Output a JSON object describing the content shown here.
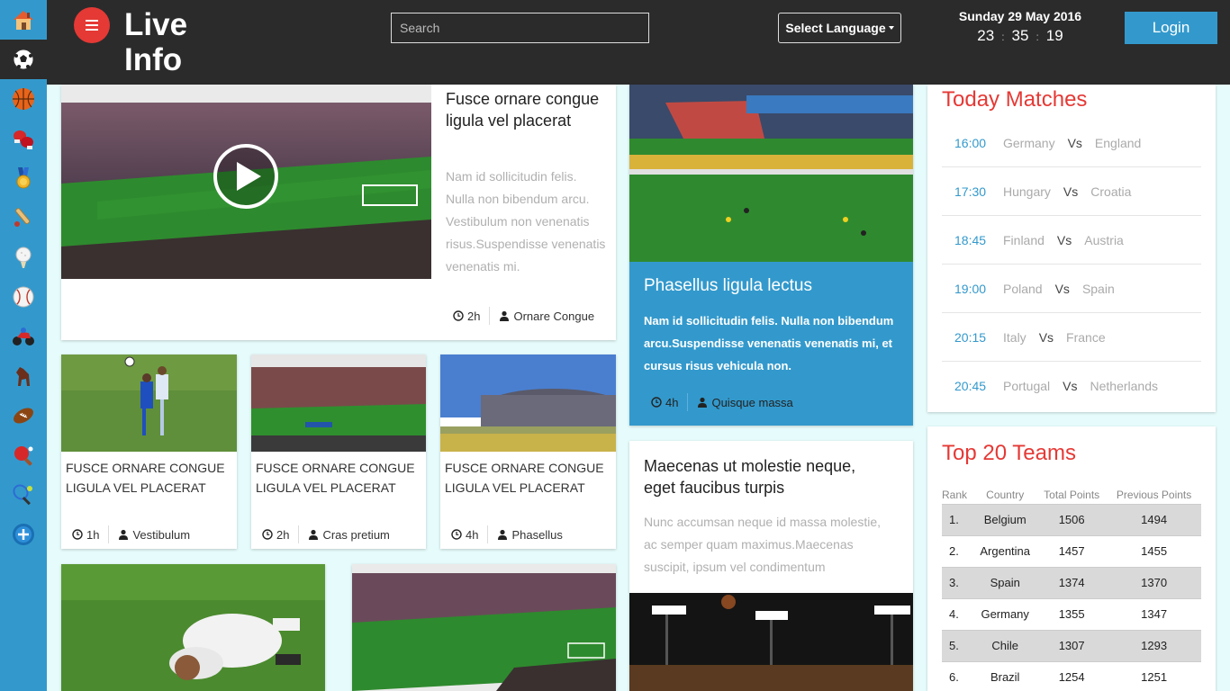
{
  "sidebar": {
    "items": [
      {
        "icon": "home-icon",
        "active": false
      },
      {
        "icon": "soccer-ball-icon",
        "active": true
      },
      {
        "icon": "basketball-icon",
        "active": false
      },
      {
        "icon": "boxing-glove-icon",
        "active": false
      },
      {
        "icon": "medal-icon",
        "active": false
      },
      {
        "icon": "cricket-bat-icon",
        "active": false
      },
      {
        "icon": "golf-ball-icon",
        "active": false
      },
      {
        "icon": "baseball-icon",
        "active": false
      },
      {
        "icon": "motorbike-icon",
        "active": false
      },
      {
        "icon": "horse-icon",
        "active": false
      },
      {
        "icon": "rugby-ball-icon",
        "active": false
      },
      {
        "icon": "table-tennis-icon",
        "active": false
      },
      {
        "icon": "tennis-icon",
        "active": false
      },
      {
        "icon": "more-icon",
        "active": false
      }
    ]
  },
  "header": {
    "logo_line1": "Live",
    "logo_line2": "Info",
    "search_placeholder": "Search",
    "language_label": "Select Language",
    "date": "Sunday 29 May 2016",
    "time": {
      "h": "23",
      "m": "35",
      "s": "19"
    },
    "login_label": "Login"
  },
  "featured": {
    "title": "Fusce ornare congue ligula vel placerat",
    "body": "Nam id sollicitudin felis. Nulla non bibendum arcu. Vestibulum non venenatis risus.Suspendisse venenatis venenatis mi.",
    "time": "2h",
    "author": "Ornare Congue"
  },
  "thumbs": [
    {
      "title": "Fusce ornare congue ligula vel placerat",
      "time": "1h",
      "author": "Vestibulum"
    },
    {
      "title": "Fusce ornare congue ligula vel placerat",
      "time": "2h",
      "author": "Cras pretium"
    },
    {
      "title": "Fusce ornare congue ligula vel placerat",
      "time": "4h",
      "author": "Phasellus"
    }
  ],
  "blue_card": {
    "title": "Phasellus ligula lectus",
    "body": "Nam id sollicitudin felis. Nulla non bibendum arcu.Suspendisse venenatis venenatis mi, et cursus risus vehicula non.",
    "time": "4h",
    "author": "Quisque massa"
  },
  "white_card": {
    "title": "Maecenas ut molestie neque, eget faucibus turpis",
    "body": "Nunc accumsan neque id massa molestie, ac semper quam maximus.Maecenas suscipit, ipsum vel condimentum"
  },
  "matches": {
    "title": "Today Matches",
    "rows": [
      {
        "time": "16:00",
        "home": "Germany",
        "vs": "Vs",
        "away": "England"
      },
      {
        "time": "17:30",
        "home": "Hungary",
        "vs": "Vs",
        "away": "Croatia"
      },
      {
        "time": "18:45",
        "home": "Finland",
        "vs": "Vs",
        "away": "Austria"
      },
      {
        "time": "19:00",
        "home": "Poland",
        "vs": "Vs",
        "away": "Spain"
      },
      {
        "time": "20:15",
        "home": "Italy",
        "vs": "Vs",
        "away": "France"
      },
      {
        "time": "20:45",
        "home": "Portugal",
        "vs": "Vs",
        "away": "Netherlands"
      }
    ]
  },
  "teams": {
    "title": "Top 20 Teams",
    "headers": [
      "Rank",
      "Country",
      "Total Points",
      "Previous Points"
    ],
    "rows": [
      {
        "rank": "1.",
        "country": "Belgium",
        "total": "1506",
        "prev": "1494"
      },
      {
        "rank": "2.",
        "country": "Argentina",
        "total": "1457",
        "prev": "1455"
      },
      {
        "rank": "3.",
        "country": "Spain",
        "total": "1374",
        "prev": "1370"
      },
      {
        "rank": "4.",
        "country": "Germany",
        "total": "1355",
        "prev": "1347"
      },
      {
        "rank": "5.",
        "country": "Chile",
        "total": "1307",
        "prev": "1293"
      },
      {
        "rank": "6.",
        "country": "Brazil",
        "total": "1254",
        "prev": "1251"
      }
    ]
  },
  "colors": {
    "accent": "#3399cc",
    "red": "#e53935",
    "dark": "#2b2b2b",
    "bg": "#e6fbfb"
  }
}
